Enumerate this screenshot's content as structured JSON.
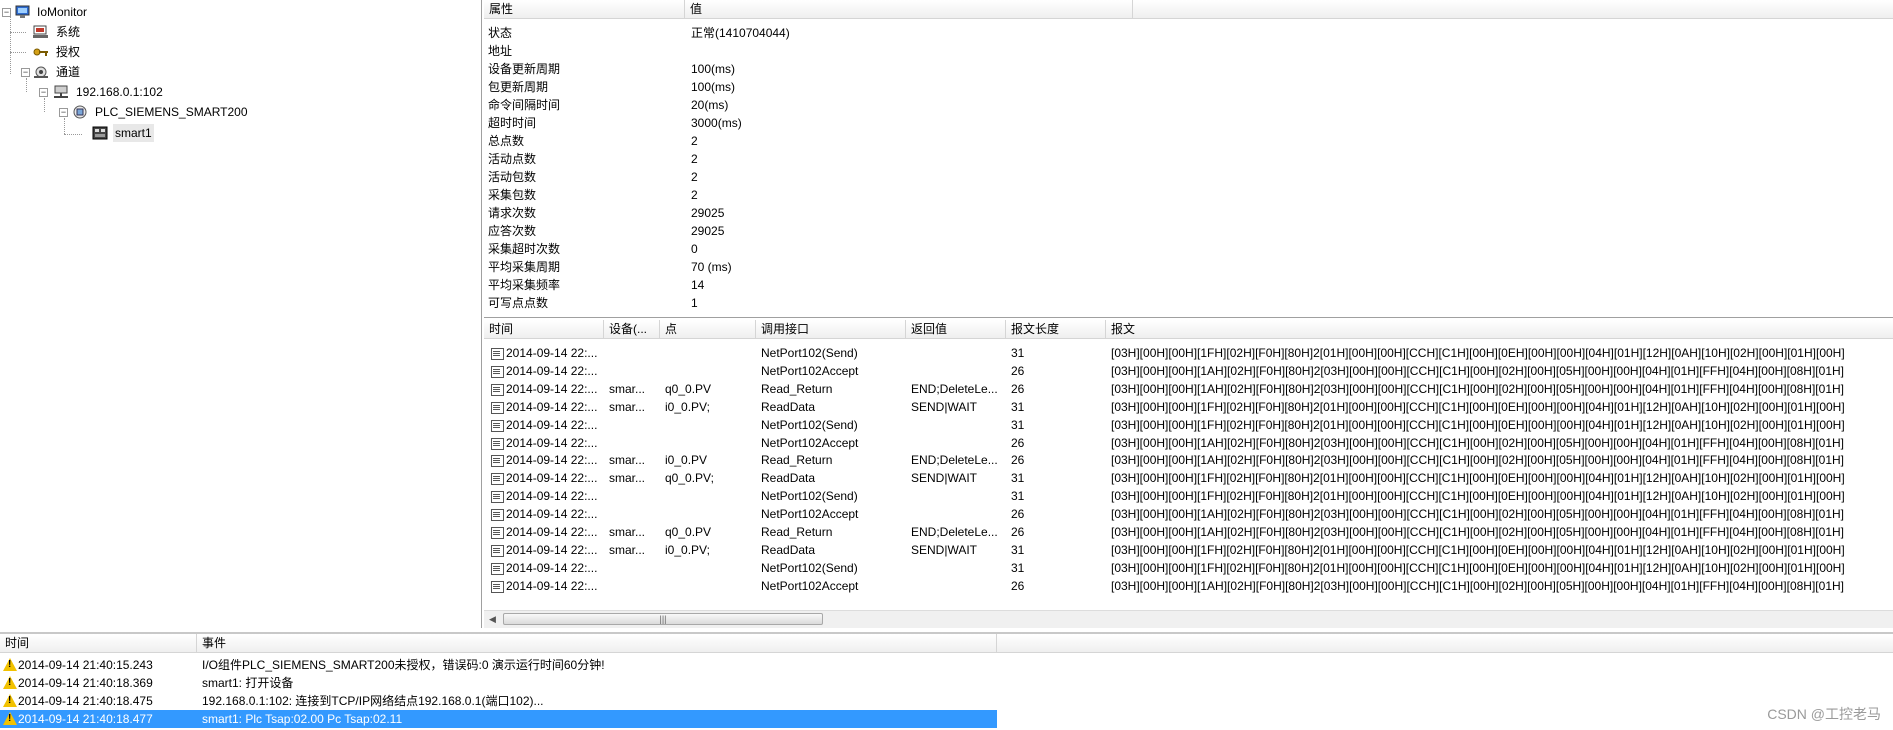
{
  "tree": {
    "root": "IoMonitor",
    "system": "系统",
    "auth": "授权",
    "channel": "通道",
    "node": "192.168.0.1:102",
    "plc": "PLC_SIEMENS_SMART200",
    "device": "smart1"
  },
  "props": {
    "col_attr": "属性",
    "col_value": "值",
    "rows": [
      {
        "k": "状态",
        "v": "正常(1410704044)"
      },
      {
        "k": "地址",
        "v": ""
      },
      {
        "k": "设备更新周期",
        "v": "100(ms)"
      },
      {
        "k": "包更新周期",
        "v": "100(ms)"
      },
      {
        "k": "命令间隔时间",
        "v": "20(ms)"
      },
      {
        "k": "超时时间",
        "v": "3000(ms)"
      },
      {
        "k": "总点数",
        "v": "2"
      },
      {
        "k": "活动点数",
        "v": "2"
      },
      {
        "k": "活动包数",
        "v": "2"
      },
      {
        "k": "采集包数",
        "v": "2"
      },
      {
        "k": "请求次数",
        "v": "29025"
      },
      {
        "k": "应答次数",
        "v": "29025"
      },
      {
        "k": "采集超时次数",
        "v": "0"
      },
      {
        "k": "平均采集周期",
        "v": "70 (ms)"
      },
      {
        "k": "平均采集频率",
        "v": "14"
      },
      {
        "k": "可写点点数",
        "v": "1"
      }
    ]
  },
  "comms": {
    "headers": [
      "时间",
      "设备(...",
      "点",
      "调用接口",
      "返回值",
      "报文长度",
      "报文"
    ],
    "rows": [
      {
        "t": "2014-09-14 22:...",
        "d": "",
        "p": "",
        "api": "NetPort102(Send)",
        "ret": "",
        "len": "31",
        "msg": "[03H][00H][00H][1FH][02H][F0H][80H]2[01H][00H][00H][CCH][C1H][00H][0EH][00H][00H][04H][01H][12H][0AH][10H][02H][00H][01H][00H]"
      },
      {
        "t": "2014-09-14 22:...",
        "d": "",
        "p": "",
        "api": "NetPort102Accept",
        "ret": "",
        "len": "26",
        "msg": "[03H][00H][00H][1AH][02H][F0H][80H]2[03H][00H][00H][CCH][C1H][00H][02H][00H][05H][00H][00H][04H][01H][FFH][04H][00H][08H][01H]"
      },
      {
        "t": "2014-09-14 22:...",
        "d": "smar...",
        "p": "q0_0.PV",
        "api": "Read_Return",
        "ret": "END;DeleteLe...",
        "len": "26",
        "msg": "[03H][00H][00H][1AH][02H][F0H][80H]2[03H][00H][00H][CCH][C1H][00H][02H][00H][05H][00H][00H][04H][01H][FFH][04H][00H][08H][01H]"
      },
      {
        "t": "2014-09-14 22:...",
        "d": "smar...",
        "p": "i0_0.PV;",
        "api": "ReadData",
        "ret": "SEND|WAIT",
        "len": "31",
        "msg": "[03H][00H][00H][1FH][02H][F0H][80H]2[01H][00H][00H][CCH][C1H][00H][0EH][00H][00H][04H][01H][12H][0AH][10H][02H][00H][01H][00H]"
      },
      {
        "t": "2014-09-14 22:...",
        "d": "",
        "p": "",
        "api": "NetPort102(Send)",
        "ret": "",
        "len": "31",
        "msg": "[03H][00H][00H][1FH][02H][F0H][80H]2[01H][00H][00H][CCH][C1H][00H][0EH][00H][00H][04H][01H][12H][0AH][10H][02H][00H][01H][00H]"
      },
      {
        "t": "2014-09-14 22:...",
        "d": "",
        "p": "",
        "api": "NetPort102Accept",
        "ret": "",
        "len": "26",
        "msg": "[03H][00H][00H][1AH][02H][F0H][80H]2[03H][00H][00H][CCH][C1H][00H][02H][00H][05H][00H][00H][04H][01H][FFH][04H][00H][08H][01H]"
      },
      {
        "t": "2014-09-14 22:...",
        "d": "smar...",
        "p": "i0_0.PV",
        "api": "Read_Return",
        "ret": "END;DeleteLe...",
        "len": "26",
        "msg": "[03H][00H][00H][1AH][02H][F0H][80H]2[03H][00H][00H][CCH][C1H][00H][02H][00H][05H][00H][00H][04H][01H][FFH][04H][00H][08H][01H]"
      },
      {
        "t": "2014-09-14 22:...",
        "d": "smar...",
        "p": "q0_0.PV;",
        "api": "ReadData",
        "ret": "SEND|WAIT",
        "len": "31",
        "msg": "[03H][00H][00H][1FH][02H][F0H][80H]2[01H][00H][00H][CCH][C1H][00H][0EH][00H][00H][04H][01H][12H][0AH][10H][02H][00H][01H][00H]"
      },
      {
        "t": "2014-09-14 22:...",
        "d": "",
        "p": "",
        "api": "NetPort102(Send)",
        "ret": "",
        "len": "31",
        "msg": "[03H][00H][00H][1FH][02H][F0H][80H]2[01H][00H][00H][CCH][C1H][00H][0EH][00H][00H][04H][01H][12H][0AH][10H][02H][00H][01H][00H]"
      },
      {
        "t": "2014-09-14 22:...",
        "d": "",
        "p": "",
        "api": "NetPort102Accept",
        "ret": "",
        "len": "26",
        "msg": "[03H][00H][00H][1AH][02H][F0H][80H]2[03H][00H][00H][CCH][C1H][00H][02H][00H][05H][00H][00H][04H][01H][FFH][04H][00H][08H][01H]"
      },
      {
        "t": "2014-09-14 22:...",
        "d": "smar...",
        "p": "q0_0.PV",
        "api": "Read_Return",
        "ret": "END;DeleteLe...",
        "len": "26",
        "msg": "[03H][00H][00H][1AH][02H][F0H][80H]2[03H][00H][00H][CCH][C1H][00H][02H][00H][05H][00H][00H][04H][01H][FFH][04H][00H][08H][01H]"
      },
      {
        "t": "2014-09-14 22:...",
        "d": "smar...",
        "p": "i0_0.PV;",
        "api": "ReadData",
        "ret": "SEND|WAIT",
        "len": "31",
        "msg": "[03H][00H][00H][1FH][02H][F0H][80H]2[01H][00H][00H][CCH][C1H][00H][0EH][00H][00H][04H][01H][12H][0AH][10H][02H][00H][01H][00H]"
      },
      {
        "t": "2014-09-14 22:...",
        "d": "",
        "p": "",
        "api": "NetPort102(Send)",
        "ret": "",
        "len": "31",
        "msg": "[03H][00H][00H][1FH][02H][F0H][80H]2[01H][00H][00H][CCH][C1H][00H][0EH][00H][00H][04H][01H][12H][0AH][10H][02H][00H][01H][00H]"
      },
      {
        "t": "2014-09-14 22:...",
        "d": "",
        "p": "",
        "api": "NetPort102Accept",
        "ret": "",
        "len": "26",
        "msg": "[03H][00H][00H][1AH][02H][F0H][80H]2[03H][00H][00H][CCH][C1H][00H][02H][00H][05H][00H][00H][04H][01H][FFH][04H][00H][08H][01H]"
      }
    ]
  },
  "events": {
    "col_time": "时间",
    "col_event": "事件",
    "rows": [
      {
        "t": "2014-09-14 21:40:15.243",
        "e": "I/O组件PLC_SIEMENS_SMART200未授权，错误码:0 演示运行时间60分钟!"
      },
      {
        "t": "2014-09-14 21:40:18.369",
        "e": "smart1: 打开设备"
      },
      {
        "t": "2014-09-14 21:40:18.475",
        "e": "192.168.0.1:102: 连接到TCP/IP网络结点192.168.0.1(端口102)..."
      },
      {
        "t": "2014-09-14 21:40:18.477",
        "e": "smart1: Plc Tsap:02.00 Pc Tsap:02.11"
      }
    ]
  },
  "watermark": "CSDN @工控老马"
}
